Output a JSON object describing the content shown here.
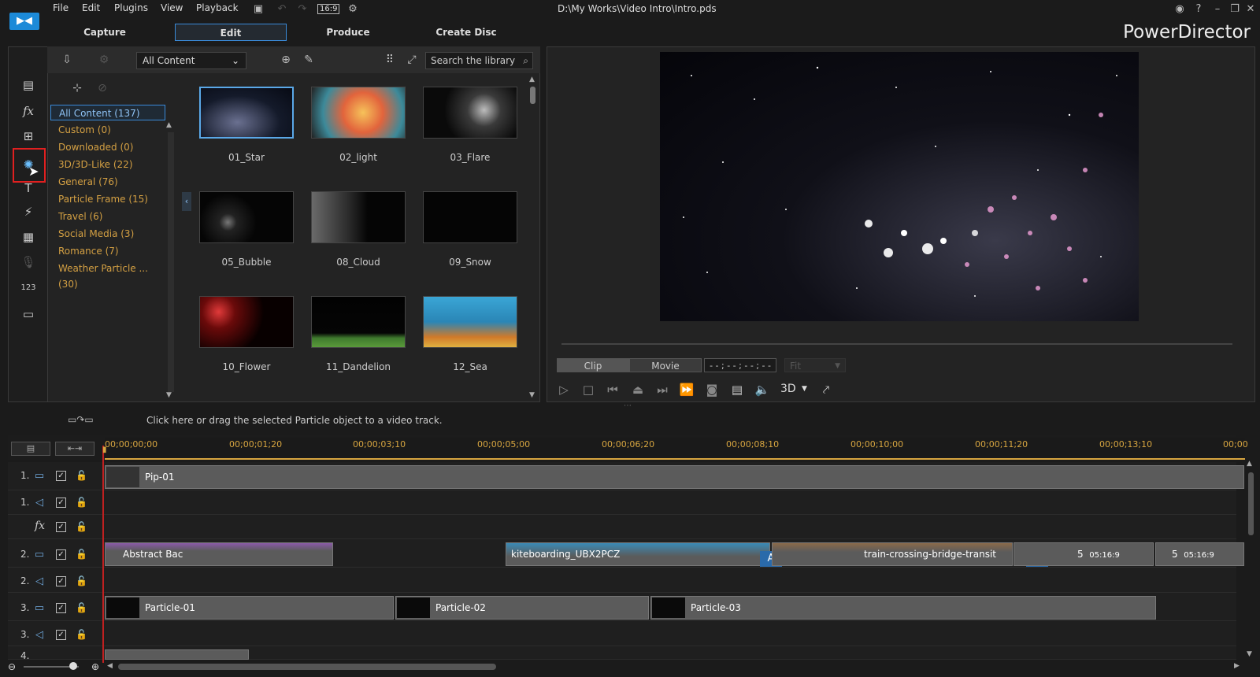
{
  "menu": {
    "file": "File",
    "edit": "Edit",
    "plugins": "Plugins",
    "view": "View",
    "playback": "Playback",
    "aspect": "16:9"
  },
  "window": {
    "path": "D:\\My Works\\Video Intro\\Intro.pds",
    "app_name": "PowerDirector"
  },
  "modes": {
    "capture": "Capture",
    "edit": "Edit",
    "produce": "Produce",
    "create_disc": "Create Disc"
  },
  "library": {
    "filter": "All Content",
    "search_placeholder": "Search the library",
    "categories": [
      {
        "label": "All Content (137)"
      },
      {
        "label": "Custom  (0)"
      },
      {
        "label": "Downloaded  (0)"
      },
      {
        "label": "3D/3D-Like  (22)"
      },
      {
        "label": "General  (76)"
      },
      {
        "label": "Particle Frame  (15)"
      },
      {
        "label": "Travel  (6)"
      },
      {
        "label": "Social Media  (3)"
      },
      {
        "label": "Romance  (7)"
      },
      {
        "label": "Weather Particle ...  (30)"
      }
    ],
    "items": [
      {
        "name": "01_Star"
      },
      {
        "name": "02_light"
      },
      {
        "name": "03_Flare"
      },
      {
        "name": "05_Bubble"
      },
      {
        "name": "08_Cloud"
      },
      {
        "name": "09_Snow"
      },
      {
        "name": "10_Flower"
      },
      {
        "name": "11_Dandelion"
      },
      {
        "name": "12_Sea"
      }
    ]
  },
  "preview": {
    "clip": "Clip",
    "movie": "Movie",
    "timecode": "- - ; - - ; - - ; - -",
    "fit": "Fit",
    "three_d": "3D"
  },
  "status_message": "Click here or drag the selected Particle object to a video track.",
  "ruler": {
    "ticks": [
      "00;00;00;00",
      "00;00;01;20",
      "00;00;03;10",
      "00;00;05;00",
      "00;00;06;20",
      "00;00;08;10",
      "00;00;10;00",
      "00;00;11;20",
      "00;00;13;10",
      "00;00"
    ]
  },
  "tracks": {
    "t1": "1.",
    "t1a": "1.",
    "t2": "2.",
    "t2a": "2.",
    "t3": "3.",
    "t3a": "3.",
    "t4": "4.",
    "clips": {
      "pip": "Pip-01",
      "abstract": "Abstract Bac",
      "kiteboarding": "kiteboarding_UBX2PCZ",
      "train": "train-crossing-bridge-transit",
      "num5a": "5",
      "num5b": "5",
      "time_a": "05:16:9",
      "time_b": "05:16:9",
      "letter_a": "A",
      "letter_b": "A",
      "particle1": "Particle-01",
      "particle2": "Particle-02",
      "particle3": "Particle-03"
    }
  }
}
